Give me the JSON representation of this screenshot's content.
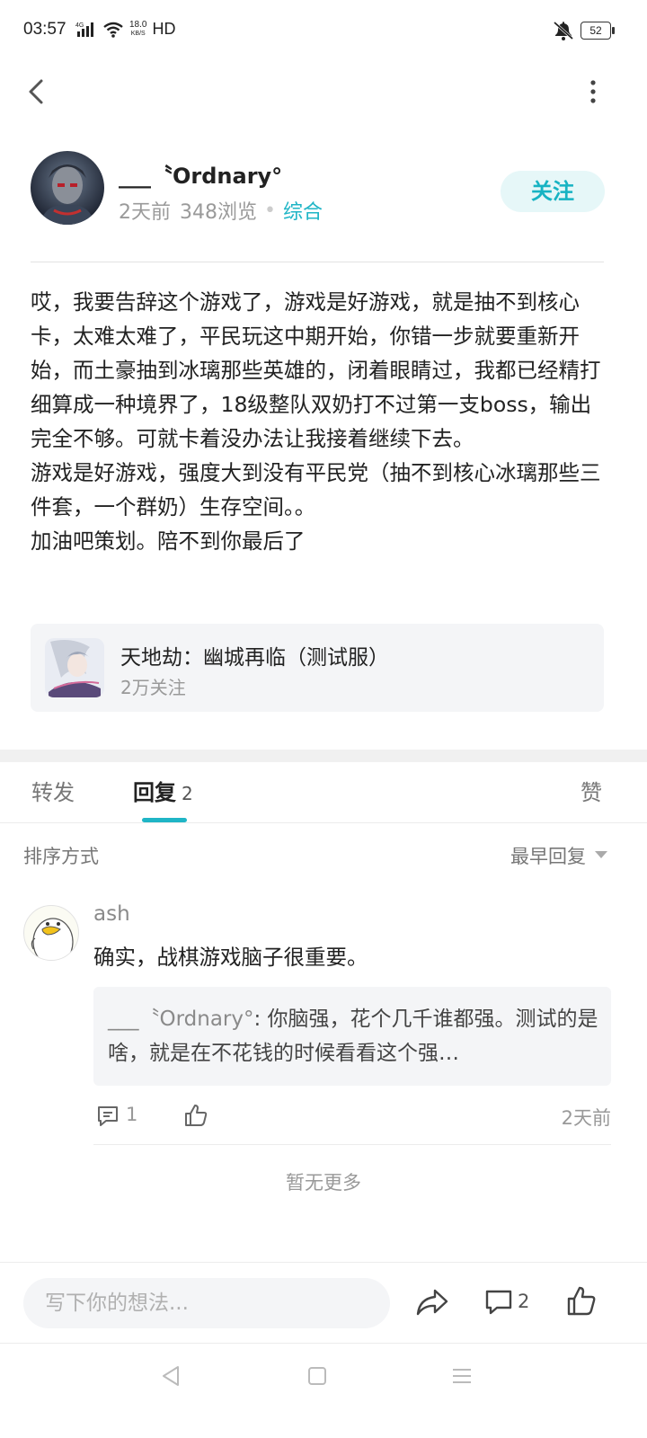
{
  "status_bar": {
    "time": "03:57",
    "network": "4G",
    "speed_value": "18.0",
    "speed_unit": "KB/S",
    "hd": "HD",
    "battery": "52",
    "icons": [
      "signal-icon",
      "wifi-icon",
      "mute-icon",
      "battery-icon"
    ]
  },
  "header": {
    "back_icon": "back-icon",
    "more_icon": "more-vertical-icon"
  },
  "author": {
    "name": "___〝Ordnary°",
    "time": "2天前",
    "views": "348浏览",
    "separator": "•",
    "category": "综合",
    "follow_label": "关注"
  },
  "post": {
    "paragraphs": [
      "哎，我要告辞这个游戏了，游戏是好游戏，就是抽不到核心卡，太难太难了，平民玩这中期开始，你错一步就要重新开始，而土豪抽到冰璃那些英雄的，闭着眼睛过，我都已经精打细算成一种境界了，18级整队双奶打不过第一支boss，输出完全不够。可就卡着没办法让我接着继续下去。",
      "游戏是好游戏，强度大到没有平民党（抽不到核心冰璃那些三件套，一个群奶）生存空间。。",
      "加油吧策划。陪不到你最后了"
    ]
  },
  "game": {
    "title": "天地劫：幽城再临（测试服）",
    "followers": "2万关注"
  },
  "tabs": {
    "repost": "转发",
    "reply": "回复",
    "reply_count": "2",
    "like": "赞"
  },
  "sort": {
    "label": "排序方式",
    "value": "最早回复"
  },
  "comments": [
    {
      "user": "ash",
      "text": "确实，战棋游戏脑子很重要。",
      "quote_user": "___〝Ordnary°",
      "quote_text": ": 你脑强，花个几千谁都强。测试的是啥，就是在不花钱的时候看看这个强…",
      "reply_count": "1",
      "time": "2天前"
    }
  ],
  "no_more": "暂无更多",
  "bottom_bar": {
    "placeholder": "写下你的想法...",
    "comment_count": "2"
  },
  "colors": {
    "accent": "#1fb5c6",
    "follow_bg": "#e6f7f8",
    "card_bg": "#f4f5f7"
  }
}
